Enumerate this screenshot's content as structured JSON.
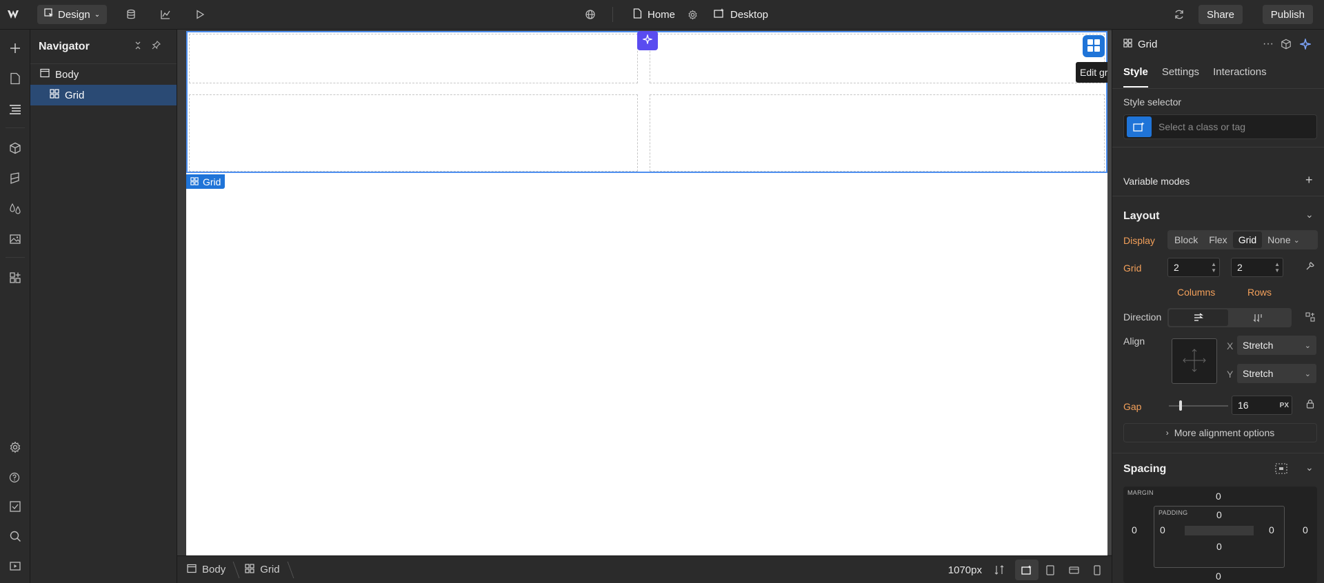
{
  "topbar": {
    "mode_label": "Design",
    "page_label": "Home",
    "breakpoint_label": "Desktop",
    "share_label": "Share",
    "publish_label": "Publish"
  },
  "navigator": {
    "title": "Navigator",
    "tree": [
      {
        "label": "Body",
        "depth": 0
      },
      {
        "label": "Grid",
        "depth": 1,
        "selected": true
      }
    ]
  },
  "canvas": {
    "selected_tag": "Grid",
    "tooltip": "Edit grid"
  },
  "breadcrumb": {
    "items": [
      "Body",
      "Grid"
    ],
    "width_label": "1070px"
  },
  "panel": {
    "element_label": "Grid",
    "tabs": [
      "Style",
      "Settings",
      "Interactions"
    ],
    "active_tab": "Style",
    "style_selector": {
      "label": "Style selector",
      "placeholder": "Select a class or tag"
    },
    "variable_modes_label": "Variable modes",
    "layout": {
      "title": "Layout",
      "display_label": "Display",
      "display_options": [
        "Block",
        "Flex",
        "Grid",
        "None"
      ],
      "display_selected": "Grid",
      "grid_label": "Grid",
      "columns_value": "2",
      "rows_value": "2",
      "columns_label": "Columns",
      "rows_label": "Rows",
      "direction_label": "Direction",
      "align_label": "Align",
      "align_x_axis": "X",
      "align_x_value": "Stretch",
      "align_y_axis": "Y",
      "align_y_value": "Stretch",
      "gap_label": "Gap",
      "gap_value": "16",
      "gap_unit": "PX",
      "more_alignment_label": "More alignment options"
    },
    "spacing": {
      "title": "Spacing",
      "margin_label": "MARGIN",
      "padding_label": "PADDING",
      "margin": {
        "top": "0",
        "right": "0",
        "bottom": "0",
        "left": "0"
      },
      "padding": {
        "top": "0",
        "right": "0",
        "bottom": "0",
        "left": "0"
      }
    }
  },
  "colors": {
    "accent_blue": "#1f74d8",
    "ai_purple": "#5a4cf0",
    "property_orange": "#f3a05a",
    "selected_row": "#2a4a74"
  }
}
